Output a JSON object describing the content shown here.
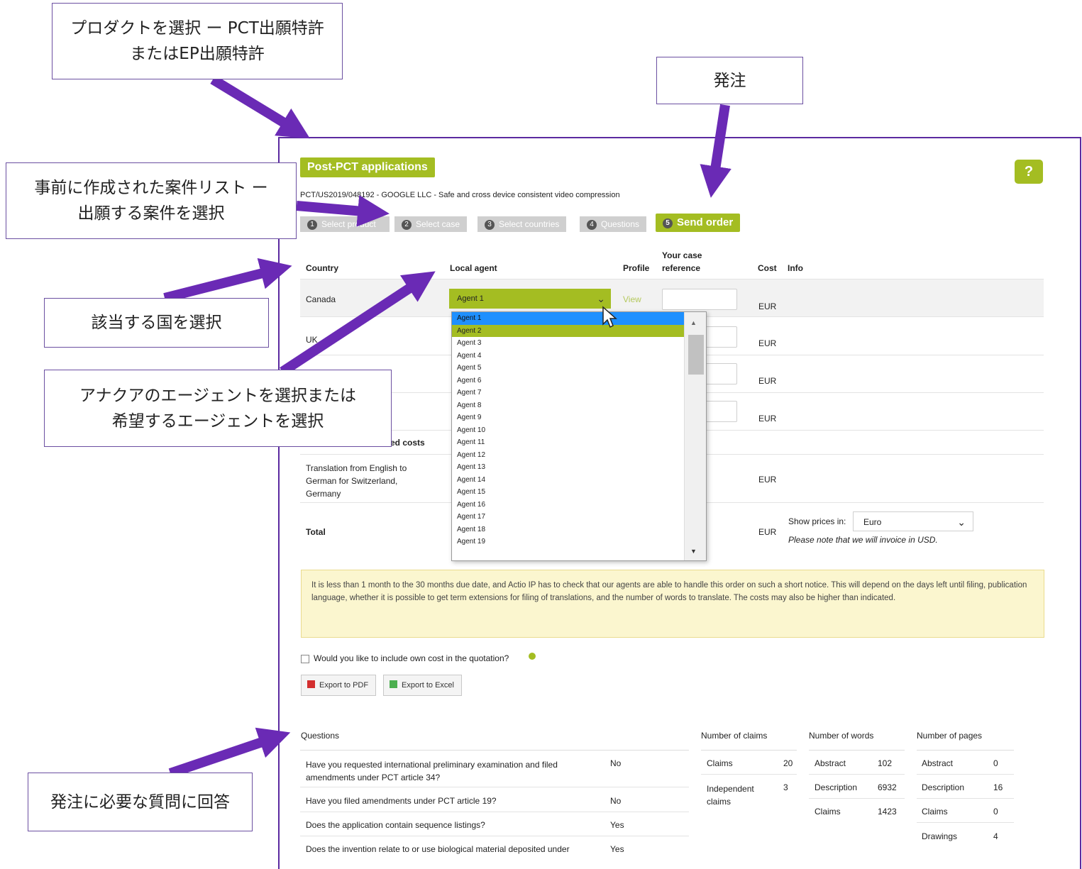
{
  "header": {
    "product_tag": "Post-PCT applications",
    "help_label": "?",
    "case_line": "PCT/US2019/048192 - GOOGLE LLC - Safe and cross device consistent video compression"
  },
  "steps": [
    {
      "num": "1",
      "label": "Select product"
    },
    {
      "num": "2",
      "label": "Select case"
    },
    {
      "num": "3",
      "label": "Select countries"
    },
    {
      "num": "4",
      "label": "Questions"
    },
    {
      "num": "5",
      "label": "Send order"
    }
  ],
  "table": {
    "headers": {
      "country": "Country",
      "agent": "Local agent",
      "profile": "Profile",
      "ref_line1": "Your case",
      "ref_line2": "reference",
      "cost": "Cost",
      "info": "Info"
    },
    "rows": [
      {
        "country": "Canada",
        "agent": "Agent 1",
        "profile": "View",
        "currency": "EUR"
      },
      {
        "country": "UK",
        "currency": "EUR"
      },
      {
        "currency": "EUR"
      },
      {
        "currency": "EUR"
      }
    ],
    "partial_label": "ed costs",
    "translation": {
      "line1": "Translation from English to",
      "line2": "German for Switzerland,",
      "line3": "Germany",
      "currency": "EUR"
    },
    "total": {
      "label": "Total",
      "currency": "EUR",
      "show_prices_label": "Show prices in:",
      "currency_option": "Euro",
      "invoice_note": "Please note that we will invoice in USD."
    }
  },
  "dropdown": {
    "items": [
      "Agent 1",
      "Agent 2",
      "Agent 3",
      "Agent 4",
      "Agent 5",
      "Agent 6",
      "Agent 7",
      "Agent 8",
      "Agent 9",
      "Agent 10",
      "Agent 11",
      "Agent 12",
      "Agent 13",
      "Agent 14",
      "Agent 15",
      "Agent 16",
      "Agent 17",
      "Agent 18",
      "Agent 19"
    ],
    "highlighted": "Agent 1",
    "selected": "Agent 2"
  },
  "notice": "It is less than 1 month to the 30 months due date, and Actio IP has to check that our agents are able to handle this order on such a short notice. This will depend on the days left until filing, publication language, whether it is possible to get term extensions for filing of translations, and the number of words to translate. The costs may also be higher than indicated.",
  "own_cost_label": "Would you like to include own cost in the quotation?",
  "export": {
    "pdf": "Export to PDF",
    "excel": "Export to Excel"
  },
  "questions": {
    "header": "Questions",
    "items": [
      {
        "line1": "Have you requested international preliminary examination and filed",
        "line2": "amendments under PCT article 34?",
        "answer": "No"
      },
      {
        "line1": "Have you filed amendments under PCT article 19?",
        "line2": "",
        "answer": "No"
      },
      {
        "line1": "Does the application contain sequence listings?",
        "line2": "",
        "answer": "Yes"
      },
      {
        "line1": "Does the invention relate to or use biological material deposited under",
        "line2": "",
        "answer": "Yes"
      }
    ]
  },
  "claims": {
    "header": "Number of claims",
    "claims_label": "Claims",
    "claims_value": "20",
    "indep_line1": "Independent",
    "indep_line2": "claims",
    "indep_value": "3"
  },
  "words": {
    "header": "Number of words",
    "abstract_label": "Abstract",
    "abstract_value": "102",
    "description_label": "Description",
    "description_value": "6932",
    "claims_label": "Claims",
    "claims_value": "1423"
  },
  "pages": {
    "header": "Number of pages",
    "abstract_label": "Abstract",
    "abstract_value": "0",
    "description_label": "Description",
    "description_value": "16",
    "claims_label": "Claims",
    "claims_value": "0",
    "drawings_label": "Drawings",
    "drawings_value": "4"
  },
  "callouts": {
    "product_line1": "プロダクトを選択 ー PCT出願特許",
    "product_line2": "またはEP出願特許",
    "order": "発注",
    "case_line1": "事前に作成された案件リスト ー",
    "case_line2": "出願する案件を選択",
    "country": "該当する国を選択",
    "agent_line1": "アナクアのエージェントを選択または",
    "agent_line2": "希望するエージェントを選択",
    "questions": "発注に必要な質問に回答"
  },
  "colors": {
    "accent": "#a4bd22",
    "arrow": "#6a2ab5",
    "frame": "#5b2aa0",
    "highlight": "#1e90ff",
    "notice_bg": "#fbf6cf"
  }
}
